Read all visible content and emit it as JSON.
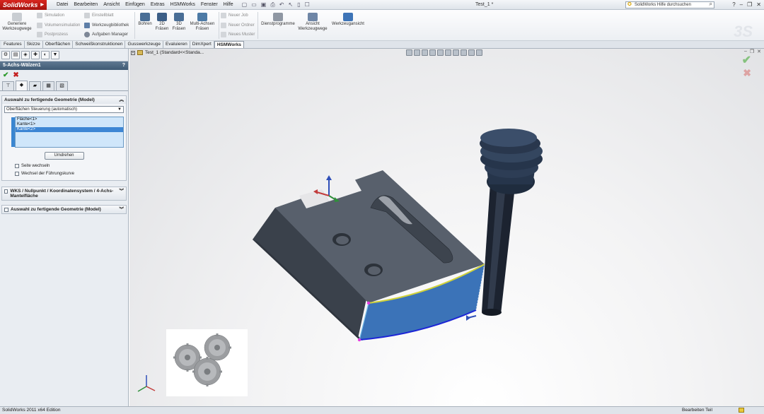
{
  "app": {
    "logo": "SolidWorks",
    "menu": [
      "Datei",
      "Bearbeiten",
      "Ansicht",
      "Einfügen",
      "Extras",
      "HSMWorks",
      "Fenster",
      "Hilfe"
    ],
    "document_title": "Test_1 *",
    "help_search_placeholder": "SolidWorks Hilfe durchsuchen"
  },
  "ribbon": {
    "generate_toolpaths": "Generiere Werkzeugwege",
    "simulation": "Simulation",
    "volume_simulation": "Volumensimulation",
    "postprocess": "Postprozess",
    "setup_sheet": "Einstellblatt",
    "tool_library": "Werkzeugbibliothek",
    "task_manager": "Aufgaben Manager",
    "drilling": "Bohren",
    "milling_2d": "2D Fräsen",
    "milling_3d": "3D Fräsen",
    "multi_axis": "Multi-Achsen Fräsen",
    "new_job": "Neuer Job",
    "new_folder": "Neuer Ordner",
    "new_pattern": "Neues Muster",
    "utilities": "Dienstprogramme",
    "view_toolpaths": "Ansicht Werkzeugwege",
    "tool_view": "Werkzeugansicht"
  },
  "tabs": [
    "Features",
    "Skizze",
    "Oberflächen",
    "Schweißkonstruktionen",
    "Gusswerkzeuge",
    "Evaluieren",
    "DimXpert",
    "HSMWorks"
  ],
  "active_tab": "HSMWorks",
  "property_manager": {
    "title": "5-Achs-Wälzen1",
    "help": "?",
    "group_geometry": {
      "title": "Auswahl zu fertigende Geometrie (Model)",
      "dropdown_value": "Oberflächen Steuerung (automatisch)",
      "list": [
        "Fläche<1>",
        "Kante<1>",
        "Kante<2>"
      ],
      "selected_index": 2,
      "reverse_button": "Umdrehen",
      "checkbox_switch_side": "Seite wechseln",
      "checkbox_switch_guide": "Wechsel der Führungskurve"
    },
    "group_wcs": {
      "title": "WKS / Nullpunkt / Koordinatensystem / 4-Achs-Mantelfläche"
    },
    "group_geometry2": {
      "title": "Auswahl zu fertigende Geometrie (Model)"
    }
  },
  "tree": {
    "label": "Test_1  (Standard<<Standa..."
  },
  "status": {
    "left": "SolidWorks 2011 x64 Edition",
    "right": "Bearbeiten Teil"
  },
  "colors": {
    "part_body": "#4d5663",
    "selected_face": "#3d73b8",
    "edge_yellow": "#d8d63a",
    "edge_blue": "#1c25d6",
    "tool": "#1f2b3d",
    "title_red": "#c31d18"
  }
}
